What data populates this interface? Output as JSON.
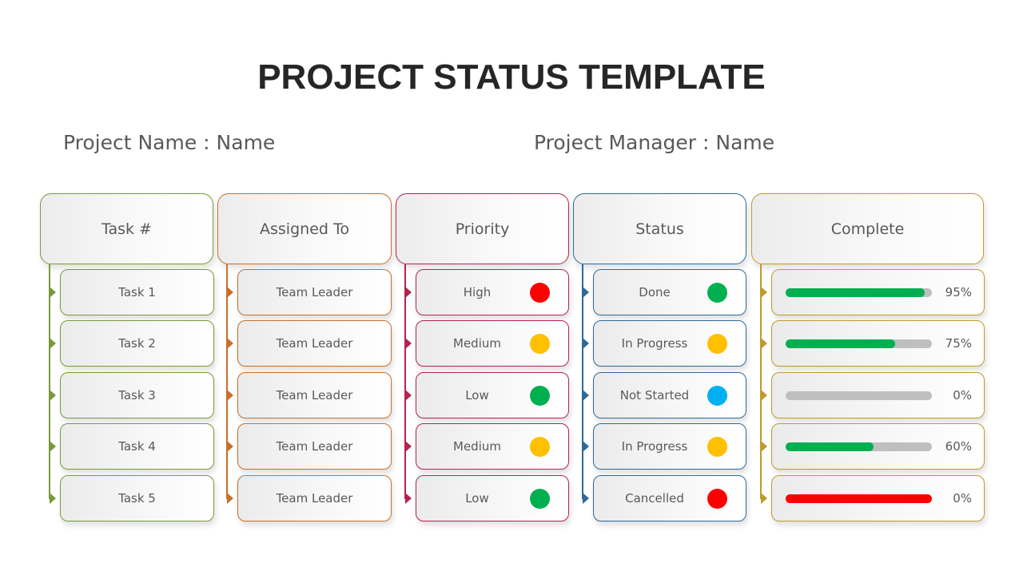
{
  "title": "PROJECT STATUS TEMPLATE",
  "project_name": "Project Name : Name",
  "project_manager": "Project Manager : Name",
  "colors": {
    "task_col": "#7a9a3a",
    "assigned_col": "#c8702a",
    "priority_col": "#b5234f",
    "status_col": "#2e6a9a",
    "complete_col": "#c19a2a",
    "red": "#ff0000",
    "yellow": "#ffc000",
    "green": "#00b050",
    "blue": "#00b0f0",
    "track": "#bfbfbf"
  },
  "headers": {
    "task": "Task #",
    "assigned": "Assigned To",
    "priority": "Priority",
    "status": "Status",
    "complete": "Complete"
  },
  "rows": [
    {
      "task": "Task 1",
      "assigned": "Team Leader",
      "priority": "High",
      "priority_color": "#ff0000",
      "status": "Done",
      "status_color": "#00b050",
      "complete_pct": 95,
      "complete_label": "95%",
      "bar_color": "#00b050"
    },
    {
      "task": "Task 2",
      "assigned": "Team Leader",
      "priority": "Medium",
      "priority_color": "#ffc000",
      "status": "In Progress",
      "status_color": "#ffc000",
      "complete_pct": 75,
      "complete_label": "75%",
      "bar_color": "#00b050"
    },
    {
      "task": "Task 3",
      "assigned": "Team Leader",
      "priority": "Low",
      "priority_color": "#00b050",
      "status": "Not Started",
      "status_color": "#00b0f0",
      "complete_pct": 0,
      "complete_label": "0%",
      "bar_color": "#bfbfbf"
    },
    {
      "task": "Task 4",
      "assigned": "Team Leader",
      "priority": "Medium",
      "priority_color": "#ffc000",
      "status": "In Progress",
      "status_color": "#ffc000",
      "complete_pct": 60,
      "complete_label": "60%",
      "bar_color": "#00b050"
    },
    {
      "task": "Task 5",
      "assigned": "Team Leader",
      "priority": "Low",
      "priority_color": "#00b050",
      "status": "Cancelled",
      "status_color": "#ff0000",
      "complete_pct": 100,
      "complete_label": "0%",
      "bar_color": "#ff0000"
    }
  ]
}
